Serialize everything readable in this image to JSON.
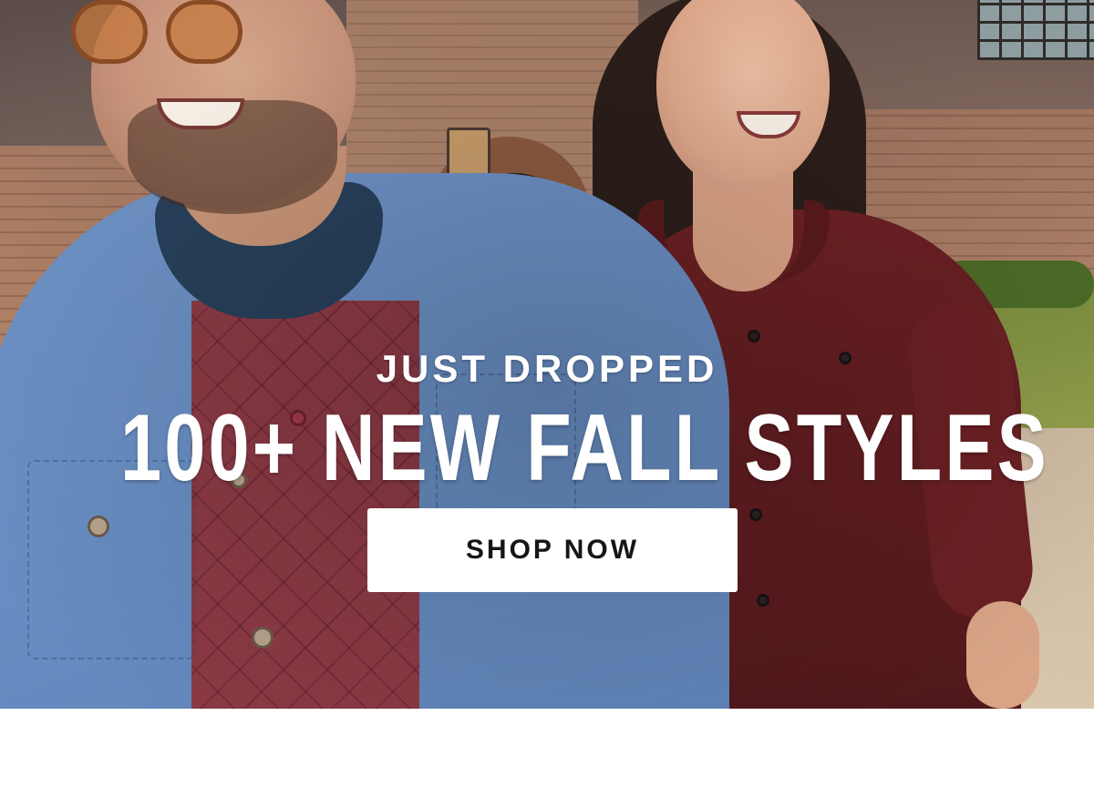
{
  "hero": {
    "image_alt": "Man in blue shirt jacket and woman in burgundy corduroy dress walking and laughing in front of a brick building",
    "eyebrow": "JUST DROPPED",
    "headline": "100+ NEW FALL STYLES",
    "cta_label": "SHOP NOW"
  },
  "colors": {
    "cta_background": "#ffffff",
    "cta_text": "#151515",
    "overlay_text": "#ffffff",
    "page_background": "#ffffff"
  }
}
